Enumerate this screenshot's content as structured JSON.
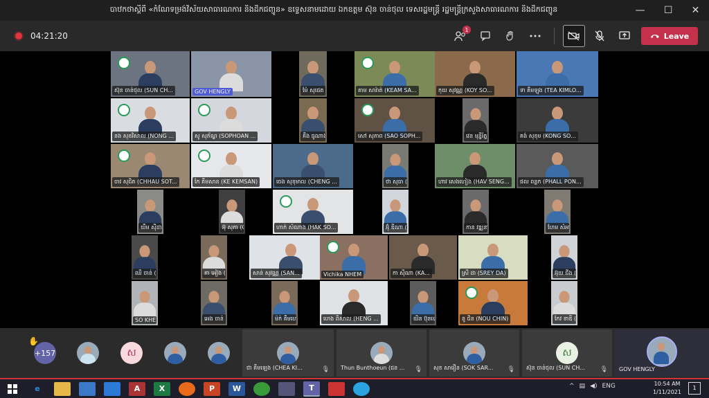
{
  "window": {
    "title": "បាឋកថាស្តីពី «កំណែទម្រង់វិស័យសាធារណការ និងដឹកជញ្ជូន» ឧទ្ទេសនាមដោយ ឯកឧត្តម ស៊ុន ចាន់ថុល ទេសរដ្ឋមន្ត្រី រដ្ឋមន្ត្រីក្រសួងសាធារណការ និងដឹកជញ្ជូន",
    "controls": {
      "minimize": "—",
      "maximize": "☐",
      "close": "✕"
    }
  },
  "toolbar": {
    "recording_time": "04:21:20",
    "participants_badge": "1",
    "leave_label": "Leave"
  },
  "tiles": [
    {
      "label": "ស៊ុន ចាន់ថុល (SUN CH...",
      "host": false
    },
    {
      "label": "GOV HENGLY",
      "host": true
    },
    {
      "label": "ម៉ែ សុផេត (ME SOPHET...",
      "host": false
    },
    {
      "label": "គាម សារ៉ាត់ (KEAM SA...",
      "host": false
    },
    {
      "label": "កុយ សុវណ្ណ (KOY SO...",
      "host": false
    },
    {
      "label": "ទា គីមឡុង (TEA KIMLO...",
      "host": false
    },
    {
      "label": "នង សុខវិសាល (NONG ...",
      "host": false
    },
    {
      "label": "សូ សុភ័ណ្ឌ (SOPHOAN ...",
      "host": false
    },
    {
      "label": "គឹង ធូណាង (GENG THO...",
      "host": false
    },
    {
      "label": "សៅ សុភាព (SAO SOPH...",
      "host": false
    },
    {
      "label": "វេន មុន្នីរ័ត្ន (VEN MONY...",
      "host": false
    },
    {
      "label": "គង់ សុខុម (KONG SO...",
      "host": false
    },
    {
      "label": "ចាវ សុជិត (CHHAU SOT...",
      "host": false
    },
    {
      "label": "កែ គឹមសាន (KE KEMSAN)",
      "host": false
    },
    {
      "label": "ចេង សុខុមាល (CHENG ...",
      "host": false
    },
    {
      "label": "ថា សុធា (THA SOTHEA)",
      "host": false
    },
    {
      "label": "ហាវ សេងហៀង (HAV SENG...",
      "host": false
    },
    {
      "label": "ផល ពន្លក (PHALL PON...",
      "host": false
    },
    {
      "label": "យឹម ស៊ីដា (YIM SIDA...",
      "host": false
    },
    {
      "label": "អ៊ុ សុភា (OR SOPHEA)",
      "host": false
    },
    {
      "label": "ហាក់ សំណាង (HAK SO...",
      "host": false
    },
    {
      "label": "អ៊ុំ ឌីណា (ORUM DEY...",
      "host": false
    },
    {
      "label": "កាន វឌ្ឍនា (KAN WATH...",
      "host": false
    },
    {
      "label": "ហែម សំអាត (HEM SAM...",
      "host": false
    },
    {
      "label": "ឈី ចាន់ (CHHI CH...",
      "host": false
    },
    {
      "label": "គា អៀង (KEA EANG)",
      "host": false
    },
    {
      "label": "សាន់ សុវណ្ណ (SAN...",
      "host": false
    },
    {
      "label": "Vichika NHEM",
      "host": false
    },
    {
      "label": "កា ស៊ីណា (KA...",
      "host": false
    },
    {
      "label": "ស្រី ដា (SREY DA)",
      "host": false
    },
    {
      "label": "អ៊ុយ ជីង (UY CHING)",
      "host": false
    },
    {
      "label": "SO KHENG",
      "host": false
    },
    {
      "label": "អេង ចាន់ (ENG C...",
      "host": false
    },
    {
      "label": "ម៉ក់ គឹមហេង (MO...",
      "host": false
    },
    {
      "label": "ហេង ពិសាល (HENG ...",
      "host": false
    },
    {
      "label": "យិន ប៊ុនឡេ (YIN B...",
      "host": false
    },
    {
      "label": "នូ ជិន (NOU CHIN)",
      "host": false
    },
    {
      "label": "កែវ ខាឌី (KEO KADY)",
      "host": false
    }
  ],
  "strip": {
    "more_count": "+157",
    "avatars": [
      {
        "kind": "photo"
      },
      {
        "kind": "letter",
        "letter": "ស"
      },
      {
        "kind": "photo"
      },
      {
        "kind": "photo"
      }
    ],
    "tiles": [
      {
        "name": "ជា គឹមឡេង (CHEA KI..."
      },
      {
        "name": "Thun Bunthoeun (ជន ..."
      },
      {
        "name": "សុខ សារឿន (SOK SAR..."
      },
      {
        "name": "ស៊ុន ចាន់ថុល (SUN CH...",
        "letter": "ស"
      },
      {
        "name": "GOV HENGLY"
      }
    ]
  },
  "taskbar": {
    "lang": "ENG",
    "time": "10:54 AM",
    "date": "1/11/2021",
    "notification_count": "1"
  },
  "colors": {
    "leave": "#c4314b",
    "teams": "#6264a7",
    "accent_red": "#d13438"
  }
}
